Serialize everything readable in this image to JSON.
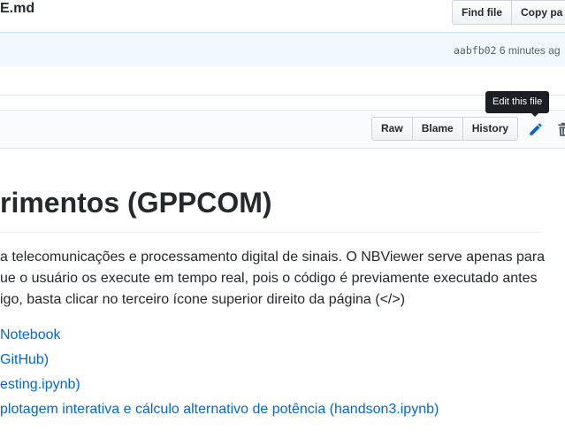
{
  "header": {
    "file_path": "E.md",
    "find_file_label": "Find file",
    "copy_path_label": "Copy pa"
  },
  "commit": {
    "sha": "aabfb02",
    "time": "6 minutes ag"
  },
  "file_actions": {
    "raw_label": "Raw",
    "blame_label": "Blame",
    "history_label": "History",
    "edit_icon": "pencil-icon",
    "delete_icon": "trash-icon",
    "tooltip": "Edit this file"
  },
  "readme": {
    "heading": "rimentos (GPPCOM)",
    "paragraph_lines": [
      "a telecomunicações e processamento digital de sinais. O NBViewer serve apenas para",
      "ue o usuário os execute em tempo real, pois o código é previamente executado antes",
      "igo, basta clicar no terceiro ícone superior direito da página (</>)"
    ],
    "links": [
      "Notebook",
      "GitHub)",
      "esting.ipynb)",
      "plotagem interativa e cálculo alternativo de potência (handson3.ipynb)"
    ]
  },
  "colors": {
    "link": "#0366d6",
    "tooltip_bg": "#1b1f23",
    "edit_icon": "#0366d6",
    "commit_bar_bg": "#f1f8ff"
  }
}
